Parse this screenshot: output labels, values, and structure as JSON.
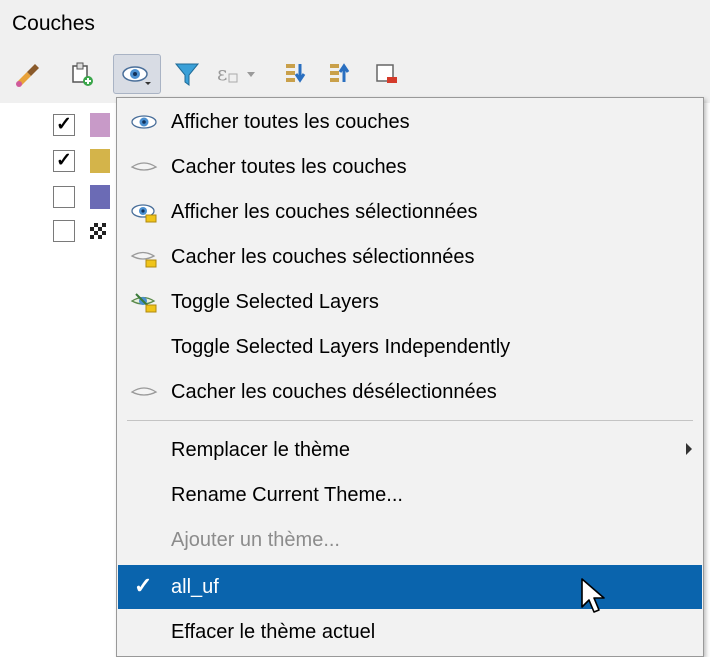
{
  "panel": {
    "title": "Couches"
  },
  "toolbar": {
    "buttons": [
      {
        "icon": "style-brush-icon"
      },
      {
        "icon": "add-group-icon"
      },
      {
        "icon": "visibility-eye-icon",
        "active": true
      },
      {
        "icon": "filter-funnel-icon"
      },
      {
        "icon": "filter-expression-icon"
      },
      {
        "icon": "expand-all-icon"
      },
      {
        "icon": "collapse-all-icon"
      },
      {
        "icon": "remove-layer-icon"
      }
    ]
  },
  "layers": [
    {
      "checked": true,
      "check_mark": "✓",
      "swatch": "#c89ac8"
    },
    {
      "checked": true,
      "check_mark": "✓",
      "swatch": "#d4b44a"
    },
    {
      "checked": false,
      "check_mark": "",
      "swatch": "#6b6bb5"
    },
    {
      "checked": false,
      "check_mark": "",
      "swatch": "checker"
    }
  ],
  "menu": {
    "items": [
      {
        "label": "Afficher toutes les couches",
        "icon": "eye-open-icon"
      },
      {
        "label": "Cacher toutes les couches",
        "icon": "eye-closed-icon"
      },
      {
        "label": "Afficher les couches sélectionnées",
        "icon": "eye-selected-icon"
      },
      {
        "label": "Cacher les couches sélectionnées",
        "icon": "eye-hide-selected-icon"
      },
      {
        "label": "Toggle Selected Layers",
        "icon": "eye-toggle-icon"
      },
      {
        "label": "Toggle Selected Layers Independently",
        "icon": ""
      },
      {
        "label": "Cacher les couches désélectionnées",
        "icon": "eye-closed-icon"
      },
      {
        "label": "Remplacer le thème",
        "submenu": true
      },
      {
        "label": "Rename Current Theme..."
      },
      {
        "label": "Ajouter un thème...",
        "disabled": true
      },
      {
        "label": "all_uf",
        "checked": true,
        "check_mark": "✓",
        "highlighted": true
      },
      {
        "label": "Effacer le thème actuel"
      }
    ]
  },
  "colors": {
    "highlight": "#0a64ad",
    "menu_bg": "#f2f2f2"
  }
}
